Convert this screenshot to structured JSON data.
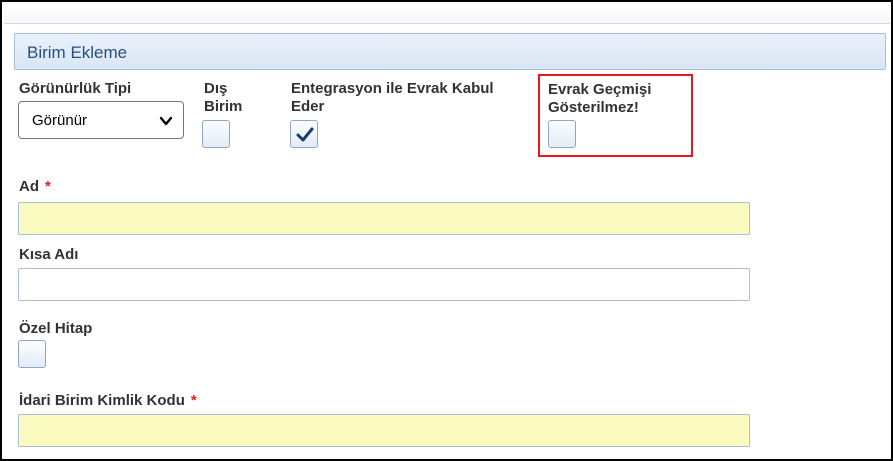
{
  "panel": {
    "title": "Birim Ekleme"
  },
  "fields": {
    "gorunurluk_tipi": {
      "label": "Görünürlük Tipi",
      "selected": "Görünür"
    },
    "dis_birim": {
      "label_line1": "Dış",
      "label_line2": "Birim",
      "checked": false
    },
    "entegrasyon": {
      "label_line1": "Entegrasyon ile Evrak Kabul",
      "label_line2": "Eder",
      "checked": true
    },
    "evrak_gecmisi": {
      "label_line1": "Evrak Geçmişi",
      "label_line2": "Gösterilmez!",
      "checked": false
    },
    "ad": {
      "label": "Ad",
      "required_mark": "*",
      "value": ""
    },
    "kisa_adi": {
      "label": "Kısa Adı",
      "value": ""
    },
    "ozel_hitap": {
      "label": "Özel Hitap",
      "checked": false
    },
    "idari_birim_kimlik_kodu": {
      "label": "İdari Birim Kimlik Kodu",
      "required_mark": "*",
      "value": ""
    }
  },
  "colors": {
    "required_field_bg": "#fbfbc0",
    "highlight_border": "#e51a1a",
    "header_text": "#2a4f7e",
    "required_mark": "#e02020"
  },
  "icons": [
    "chevron-down-icon",
    "checkmark-icon"
  ]
}
